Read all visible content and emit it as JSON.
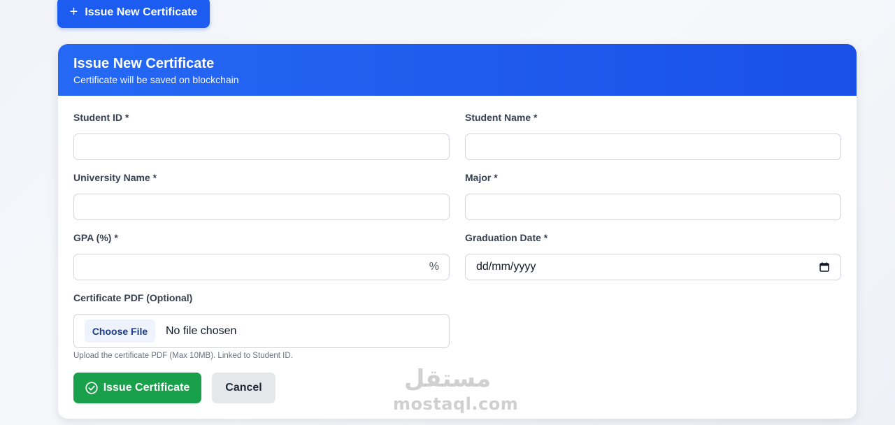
{
  "top_button": {
    "icon": "plus-icon",
    "label": "Issue New Certificate",
    "color": "#1d5cf0"
  },
  "card": {
    "title": "Issue New Certificate",
    "subtitle": "Certificate will be saved on blockchain",
    "header_color": "#1d5cf0"
  },
  "form": {
    "student_id": {
      "label": "Student ID *",
      "value": ""
    },
    "student_name": {
      "label": "Student Name *",
      "value": ""
    },
    "university_name": {
      "label": "University Name *",
      "value": ""
    },
    "major": {
      "label": "Major *",
      "value": ""
    },
    "gpa": {
      "label": "GPA (%) *",
      "value": "",
      "suffix": "%"
    },
    "graduation_date": {
      "label": "Graduation Date *",
      "placeholder": "dd/mm/yyyy",
      "icon": "calendar-icon"
    },
    "certificate_pdf": {
      "label": "Certificate PDF (Optional)",
      "choose_label": "Choose File",
      "status": "No file chosen",
      "hint": "Upload the certificate PDF (Max 10MB). Linked to Student ID."
    }
  },
  "actions": {
    "issue_label": "Issue Certificate",
    "issue_icon": "check-circle-icon",
    "issue_color": "#18a04a",
    "cancel_label": "Cancel"
  },
  "watermark": {
    "arabic": "مستقل",
    "latin": "mostaql.com"
  }
}
